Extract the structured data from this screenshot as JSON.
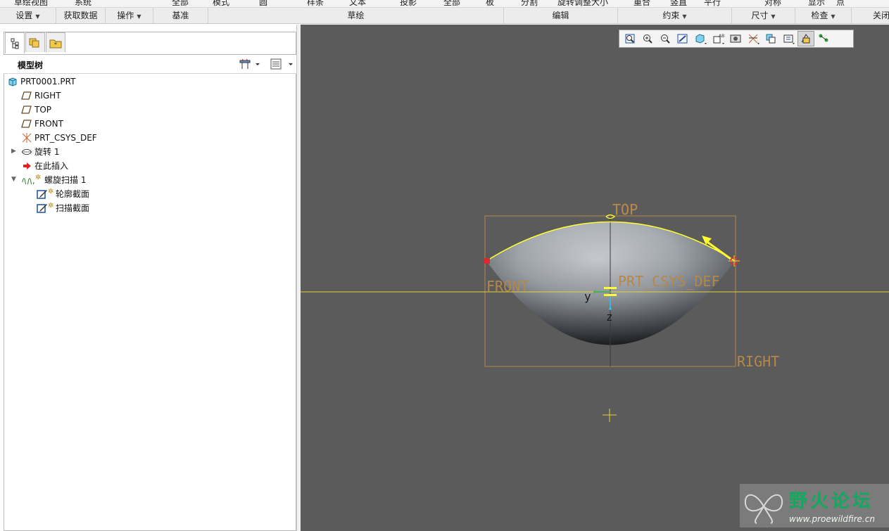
{
  "ribbon": {
    "partial_labels": [
      "草绘视图",
      "系统",
      "全部",
      "模式",
      "圆",
      "样条",
      "文本",
      "投影",
      "全部",
      "板",
      "分割",
      "旋转调整大小",
      "重合",
      "竖直",
      "平行",
      "对称",
      "显示",
      "点"
    ]
  },
  "groups": [
    {
      "label": "设置",
      "dropdown": true
    },
    {
      "label": "获取数据",
      "dropdown": false
    },
    {
      "label": "操作",
      "dropdown": true
    },
    {
      "label": "基准",
      "dropdown": false
    },
    {
      "label": "草绘",
      "dropdown": false
    },
    {
      "label": "编辑",
      "dropdown": false
    },
    {
      "label": "约束",
      "dropdown": true
    },
    {
      "label": "尺寸",
      "dropdown": true
    },
    {
      "label": "检查",
      "dropdown": true
    },
    {
      "label": "关闭",
      "dropdown": false
    }
  ],
  "left_tabs": [
    {
      "icon": "model-tree-icon",
      "active": true
    },
    {
      "icon": "folder-browser-icon",
      "active": false
    },
    {
      "icon": "favorites-icon",
      "active": false
    }
  ],
  "tree": {
    "title": "模型树",
    "settings_icon": "tree-settings-icon",
    "columns_icon": "tree-columns-icon",
    "items": [
      {
        "label": "PRT0001.PRT",
        "icon": "part-icon",
        "level": 0,
        "expander": ""
      },
      {
        "label": "RIGHT",
        "icon": "datum-plane-icon",
        "level": 1,
        "expander": ""
      },
      {
        "label": "TOP",
        "icon": "datum-plane-icon",
        "level": 1,
        "expander": ""
      },
      {
        "label": "FRONT",
        "icon": "datum-plane-icon",
        "level": 1,
        "expander": ""
      },
      {
        "label": "PRT_CSYS_DEF",
        "icon": "csys-icon",
        "level": 1,
        "expander": ""
      },
      {
        "label": "旋转 1",
        "icon": "revolve-icon",
        "level": 1,
        "expander": "▶"
      },
      {
        "label": "在此插入",
        "icon": "insert-here-arrow-icon",
        "level": 1,
        "expander": ""
      },
      {
        "label": "螺旋扫描 1",
        "icon": "helical-sweep-icon",
        "level": 1,
        "expander": "▼"
      },
      {
        "label": "轮廓截面",
        "icon": "sketch-icon",
        "level": 2,
        "expander": ""
      },
      {
        "label": "扫描截面",
        "icon": "sketch-icon",
        "level": 2,
        "expander": ""
      }
    ]
  },
  "view_toolbar": [
    {
      "icon": "refit-icon",
      "active": false
    },
    {
      "icon": "zoom-in-icon",
      "active": false
    },
    {
      "icon": "zoom-out-icon",
      "active": false
    },
    {
      "icon": "repaint-icon",
      "active": false
    },
    {
      "icon": "display-style-icon",
      "active": false
    },
    {
      "icon": "saved-orientations-icon",
      "active": false
    },
    {
      "icon": "view-manager-icon",
      "active": false
    },
    {
      "icon": "datum-display-icon",
      "active": false
    },
    {
      "icon": "annotation-display-icon",
      "active": false
    },
    {
      "icon": "spin-center-icon",
      "active": false
    },
    {
      "icon": "sketch-view-icon",
      "active": true
    },
    {
      "icon": "sketch-display-filter-icon",
      "active": false
    }
  ],
  "viewport": {
    "background": "#5b5b5b",
    "labels": {
      "top": "TOP",
      "front": "FRONT",
      "right": "RIGHT",
      "csys": "PRT_CSYS_DEF",
      "axis_y": "y",
      "axis_z": "z"
    },
    "colors": {
      "datum": "#b6874a",
      "sketch": "#ffff33",
      "endpoint": "#e2262d"
    }
  },
  "watermark": {
    "title": "野火论坛",
    "url": "www.proewildfire.cn"
  }
}
